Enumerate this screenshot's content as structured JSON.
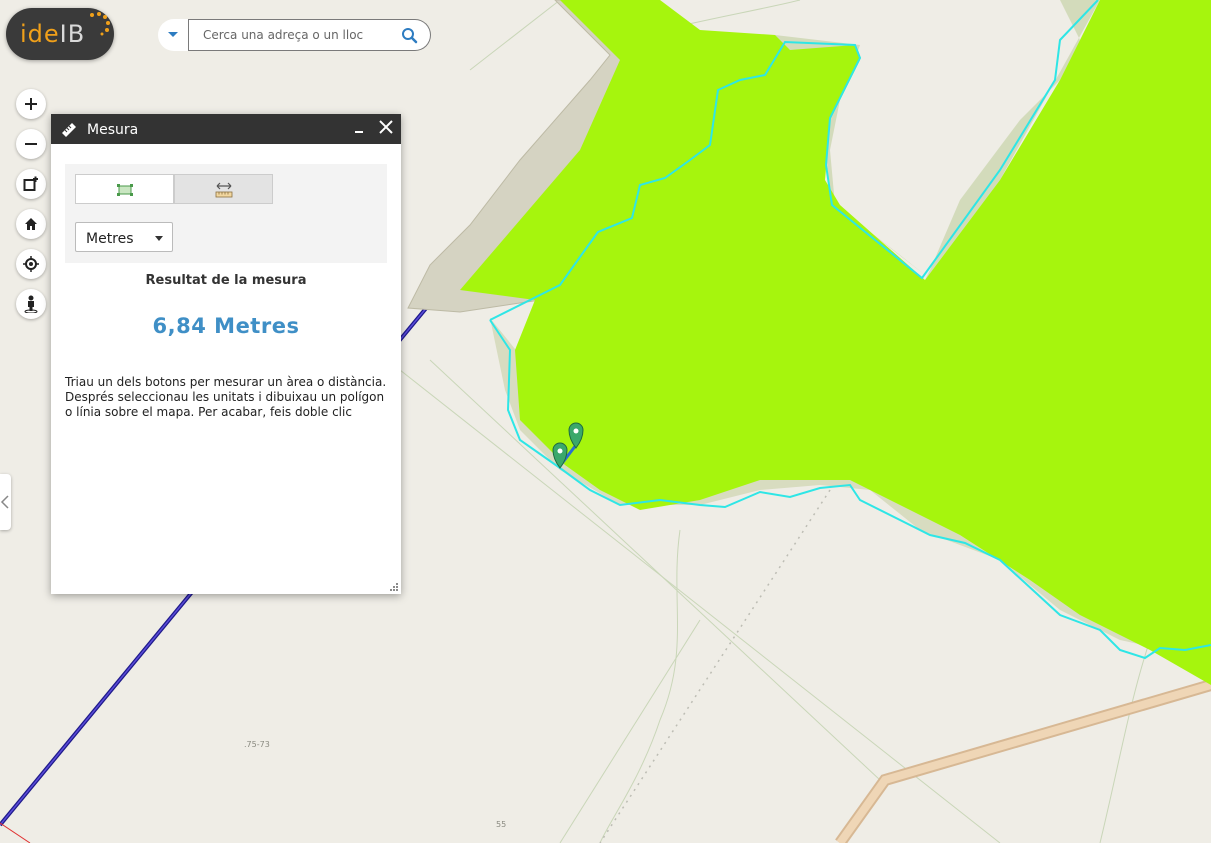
{
  "logo": {
    "ide": "ide",
    "ib": "IB"
  },
  "search": {
    "placeholder": "Cerca una adreça o un lloc"
  },
  "controls": [
    "zoom-in-icon",
    "zoom-out-icon",
    "add-layer-icon",
    "home-icon",
    "locate-icon",
    "street-view-icon"
  ],
  "panel": {
    "title": "Mesura",
    "unit": "Metres",
    "result_label": "Resultat de la mesura",
    "result_value": "6,84 Metres",
    "help": "Triau un dels botons per mesurar un àrea o distància. Després seleccionau les unitats i dibuixau un polígon o línia sobre el mapa. Per acabar, feis doble clic"
  },
  "map": {
    "labels": {
      "parcel_a": ".75-73",
      "parcel_b": "55"
    },
    "colors": {
      "zone_fill": "#a6f50d",
      "zone_outline": "#2ee6e6",
      "road": "#e9c9a6",
      "boundary": "#2a1aa8",
      "marker": "#3aa86b"
    }
  }
}
